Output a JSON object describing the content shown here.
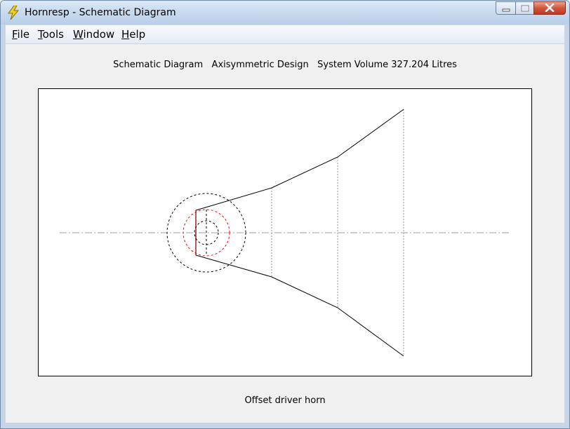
{
  "window": {
    "title": "Hornresp - Schematic Diagram",
    "app_icon": "lightning-bolt-icon"
  },
  "caption_buttons": {
    "minimize": "minimize-icon",
    "maximize": "maximize-icon",
    "close": "close-icon"
  },
  "menu": {
    "items": [
      {
        "label": "File",
        "mnemonic": "F"
      },
      {
        "label": "Tools",
        "mnemonic": "T"
      },
      {
        "label": "Window",
        "mnemonic": "W"
      },
      {
        "label": "Help",
        "mnemonic": "H"
      }
    ]
  },
  "diagram": {
    "heading": "Schematic Diagram   Axisymmetric Design   System Volume 327.204 Litres",
    "caption": "Offset driver horn"
  },
  "colors": {
    "titlebar": "#c9dbef",
    "client_background": "#f0f0f0",
    "horn_outline": "#000000",
    "throat_line": "#8b0000",
    "driver_inner_circle": "#ff0000",
    "close_button": "#c0391f"
  }
}
